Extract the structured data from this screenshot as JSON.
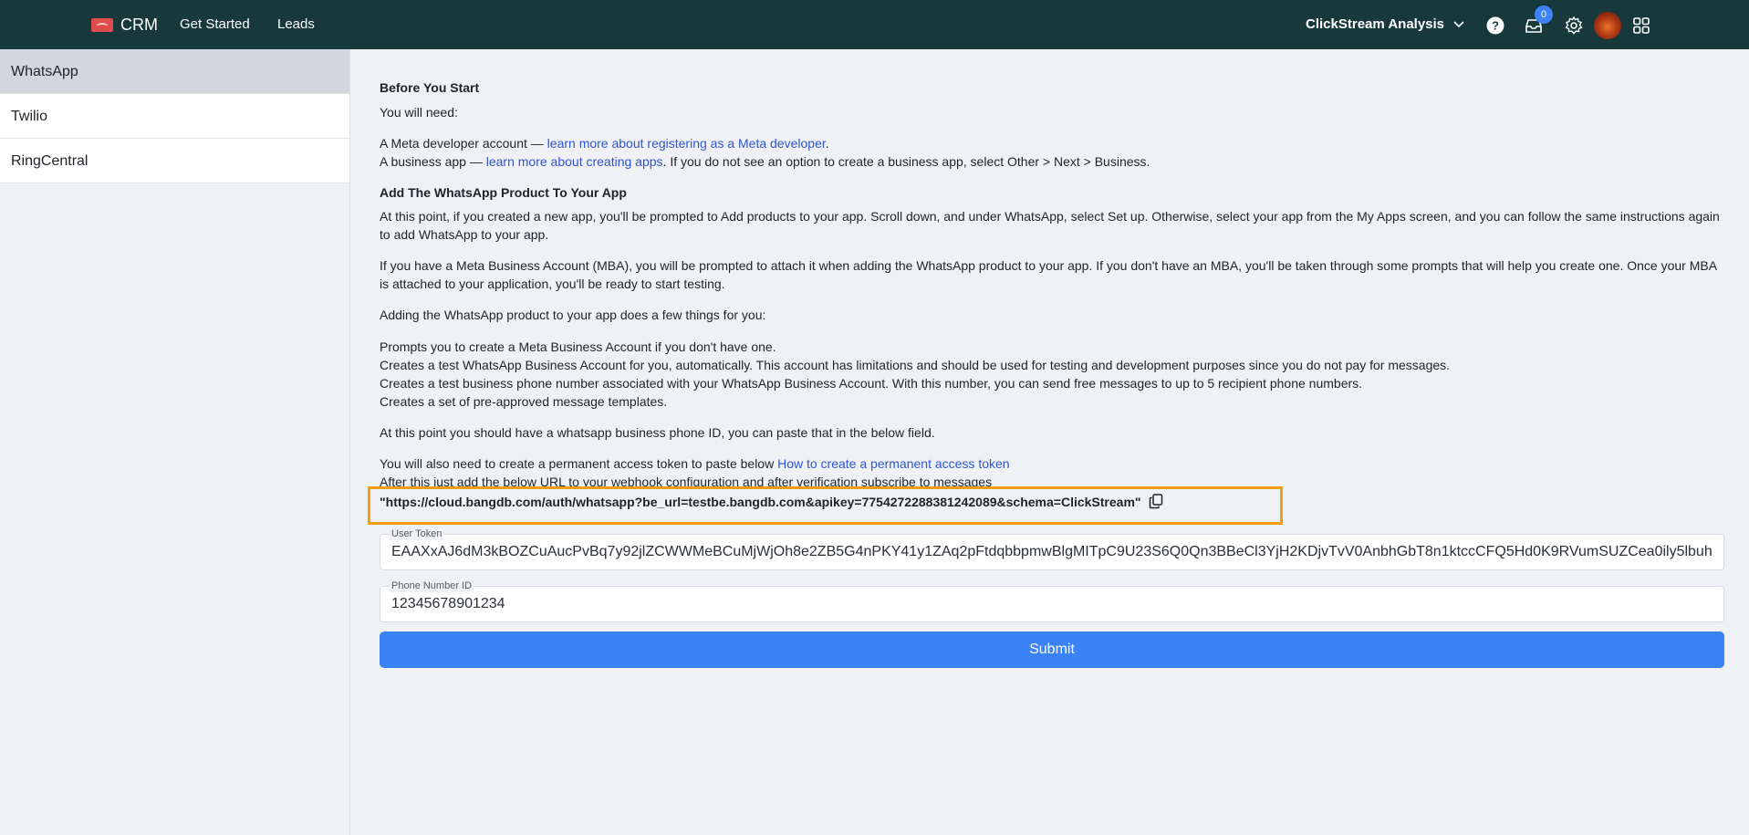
{
  "header": {
    "brand": "CRM",
    "nav": [
      {
        "label": "Get Started"
      },
      {
        "label": "Leads"
      }
    ],
    "workspace": "ClickStream Analysis",
    "notification_count": "0",
    "icons": [
      "help-icon",
      "inbox-icon",
      "settings-icon",
      "avatar",
      "apps-grid-icon"
    ],
    "colors": {
      "bar": "#17393b",
      "badge": "#3b82f6"
    }
  },
  "sidebar": {
    "items": [
      {
        "label": "WhatsApp",
        "active": true
      },
      {
        "label": "Twilio",
        "active": false
      },
      {
        "label": "RingCentral",
        "active": false
      }
    ]
  },
  "content": {
    "before_title": "Before You Start",
    "need": "You will need:",
    "meta_account_prefix": "A Meta developer account — ",
    "meta_account_link": "learn more about registering as a Meta developer",
    "meta_account_suffix": ".",
    "business_app_prefix": "A business app — ",
    "business_app_link": "learn more about creating apps",
    "business_app_suffix": ". If you do not see an option to create a business app, select Other > Next > Business.",
    "add_title": "Add The WhatsApp Product To Your App",
    "para1": "At this point, if you created a new app, you'll be prompted to Add products to your app. Scroll down, and under WhatsApp, select Set up. Otherwise, select your app from the My Apps screen, and you can follow the same instructions again to add WhatsApp to your app.",
    "para2": "If you have a Meta Business Account (MBA), you will be prompted to attach it when adding the WhatsApp product to your app. If you don't have an MBA, you'll be taken through some prompts that will help you create one. Once your MBA is attached to your application, you'll be ready to start testing.",
    "para3": "Adding the WhatsApp product to your app does a few things for you:",
    "list": [
      "Prompts you to create a Meta Business Account if you don't have one.",
      "Creates a test WhatsApp Business Account for you, automatically. This account has limitations and should be used for testing and development purposes since you do not pay for messages.",
      "Creates a test business phone number associated with your WhatsApp Business Account. With this number, you can send free messages to up to 5 recipient phone numbers.",
      "Creates a set of pre-approved message templates."
    ],
    "para4": "At this point you should have a whatsapp business phone ID, you can paste that in the below field.",
    "token_prefix": "You will also need to create a permanent access token to paste below ",
    "token_link": "How to create a permanent access token",
    "webhook_text": "After this just add the below URL to your webhook configuration and after verification subscribe to messages",
    "webhook_url": "\"https://cloud.bangdb.com/auth/whatsapp?be_url=testbe.bangdb.com&apikey=7754272288381242089&schema=ClickStream\"",
    "highlight_color": "#f59e0b"
  },
  "form": {
    "user_token_label": "User Token",
    "user_token_value": "EAAXxAJ6dM3kBOZCuAucPvBq7y92jlZCWWMeBCuMjWjOh8e2ZB5G4nPKY41y1ZAq2pFtdqbbpmwBlgMITpC9U23S6Q0Qn3BBeCl3YjH2KDjvTvV0AnbhGbT8n1ktccCFQ5Hd0K9RVumSUZCea0ily5lbuh",
    "phone_label": "Phone Number ID",
    "phone_value": "12345678901234",
    "submit_label": "Submit",
    "submit_color": "#3b82f6"
  }
}
